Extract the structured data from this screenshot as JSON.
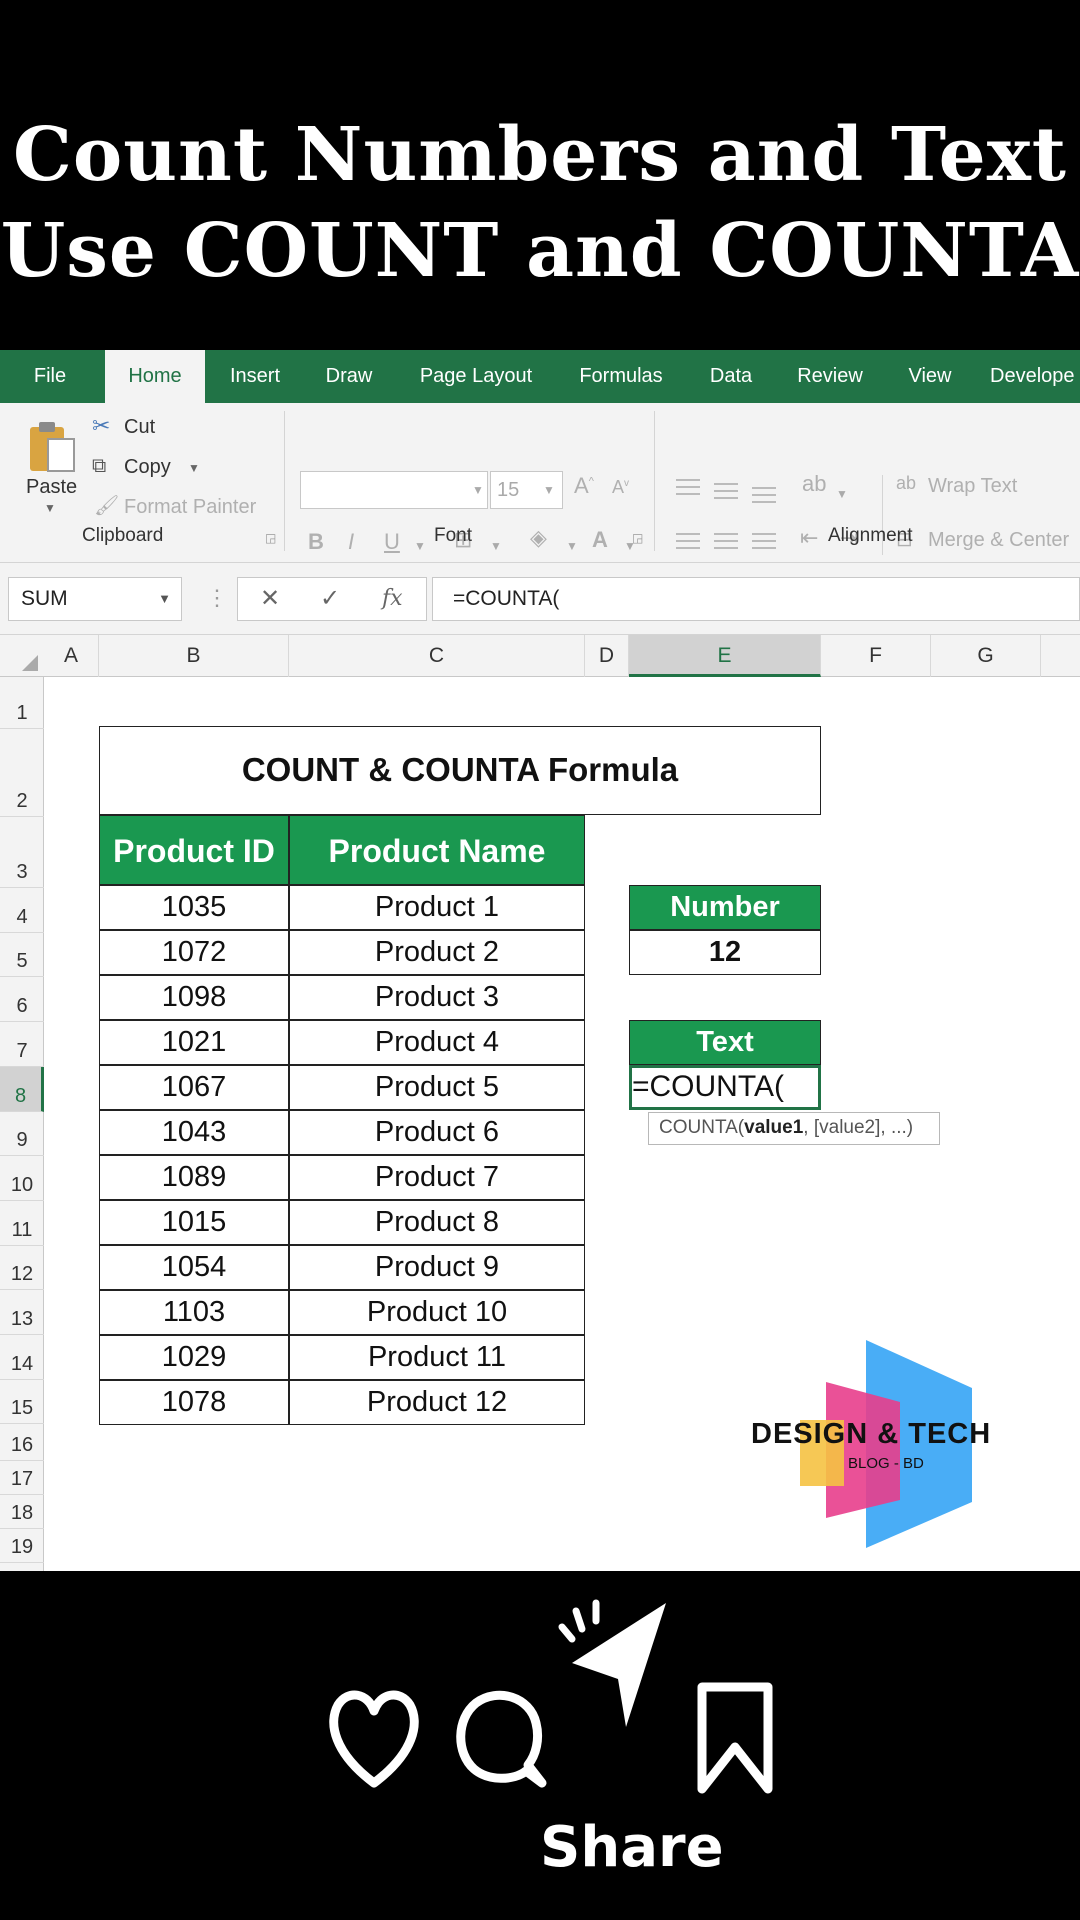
{
  "title": {
    "line1": "Count Numbers and Text",
    "line2": "Use COUNT and COUNTA"
  },
  "tabs": [
    "File",
    "Home",
    "Insert",
    "Draw",
    "Page Layout",
    "Formulas",
    "Data",
    "Review",
    "View",
    "Develope"
  ],
  "ribbon": {
    "paste": "Paste",
    "cut": "Cut",
    "copy": "Copy",
    "format_painter": "Format Painter",
    "clipboard": "Clipboard",
    "font_group": "Font",
    "alignment_group": "Alignment",
    "font_size": "15",
    "wrap_text": "Wrap Text",
    "merge_center": "Merge & Center"
  },
  "formula_bar": {
    "name_box": "SUM",
    "formula": "=COUNTA("
  },
  "columns": [
    "A",
    "B",
    "C",
    "D",
    "E",
    "F",
    "G"
  ],
  "rows": [
    "1",
    "2",
    "3",
    "4",
    "5",
    "6",
    "7",
    "8",
    "9",
    "10",
    "11",
    "12",
    "13",
    "14",
    "15",
    "16",
    "17",
    "18",
    "19"
  ],
  "sheet": {
    "table_title": "COUNT & COUNTA Formula",
    "headers": {
      "id": "Product ID",
      "name": "Product Name"
    },
    "products": [
      {
        "id": "1035",
        "name": "Product 1"
      },
      {
        "id": "1072",
        "name": "Product 2"
      },
      {
        "id": "1098",
        "name": "Product 3"
      },
      {
        "id": "1021",
        "name": "Product 4"
      },
      {
        "id": "1067",
        "name": "Product 5"
      },
      {
        "id": "1043",
        "name": "Product 6"
      },
      {
        "id": "1089",
        "name": "Product 7"
      },
      {
        "id": "1015",
        "name": "Product 8"
      },
      {
        "id": "1054",
        "name": "Product 9"
      },
      {
        "id": "1103",
        "name": "Product 10"
      },
      {
        "id": "1029",
        "name": "Product 11"
      },
      {
        "id": "1078",
        "name": "Product 12"
      }
    ],
    "number_label": "Number",
    "number_value": "12",
    "text_label": "Text",
    "text_cell": "=COUNTA(",
    "tooltip": {
      "fn": "COUNTA(",
      "arg1": "value1",
      "rest": ", [value2], ...)"
    }
  },
  "logo": {
    "name": "DESIGN & TECH",
    "sub": "BLOG - BD"
  },
  "share_label": "Share",
  "colors": {
    "excel_green": "#217346",
    "header_green": "#1a9850"
  }
}
